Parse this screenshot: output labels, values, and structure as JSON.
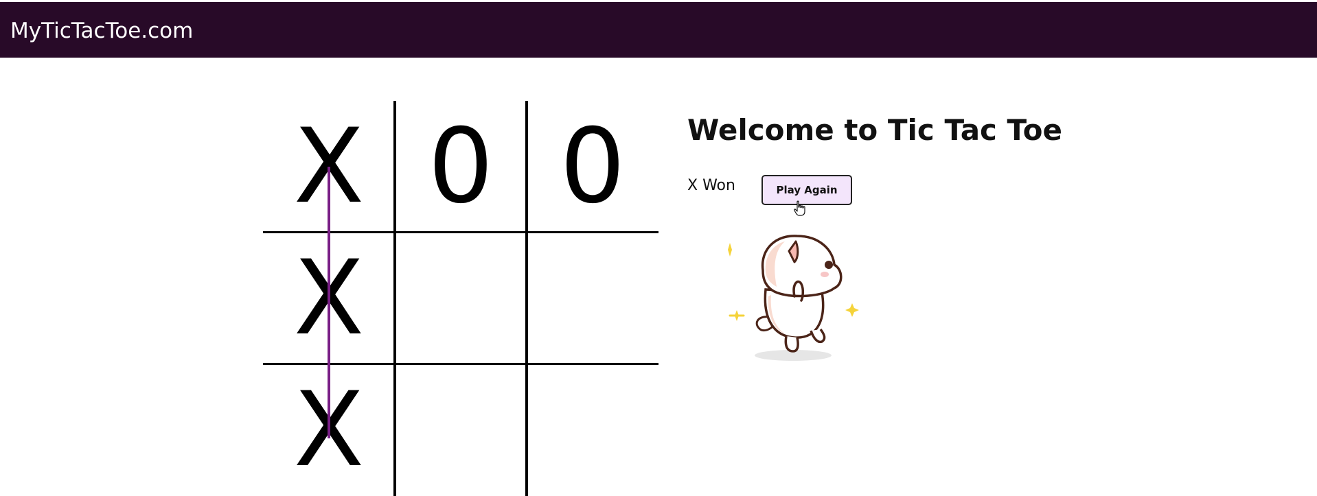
{
  "navbar": {
    "brand": "MyTicTacToe.com"
  },
  "board": {
    "cells": [
      "X",
      "0",
      "0",
      "X",
      "",
      "",
      "X",
      "",
      ""
    ],
    "winning_line_color": "#7a1f86"
  },
  "game": {
    "title": "Welcome to Tic Tac Toe",
    "status": "X Won",
    "play_again_label": "Play Again"
  },
  "colors": {
    "navbar_bg": "#280a28",
    "button_bg": "#f3e5fb"
  },
  "icons": {
    "cursor": "hand-pointer-icon",
    "illustration": "cat-illustration"
  }
}
